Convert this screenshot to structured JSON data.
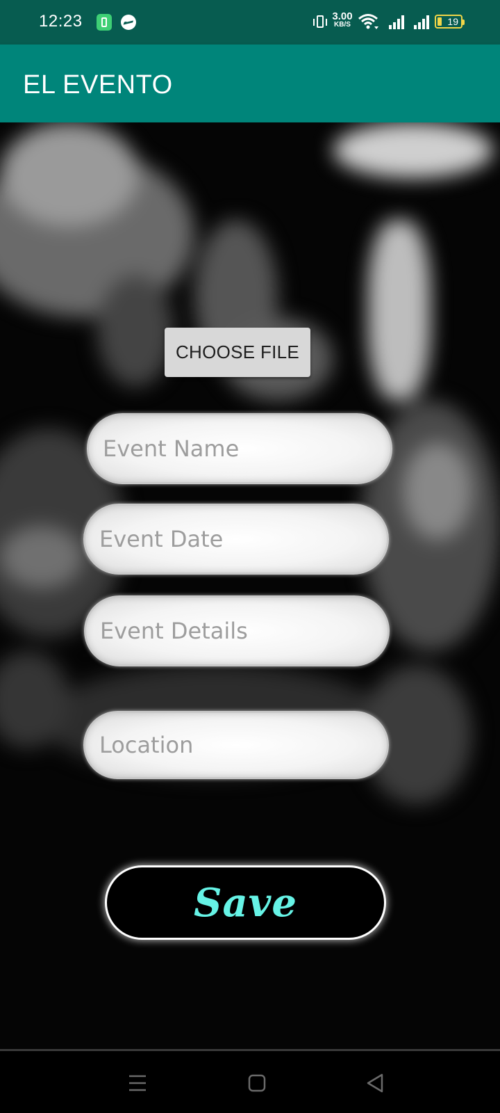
{
  "status_bar": {
    "time": "12:23",
    "network_speed_value": "3.00",
    "network_speed_unit": "KB/S",
    "battery_level": "19",
    "icons": [
      "battery-charging-notification-icon",
      "messenger-icon",
      "vibrate-icon",
      "wifi-icon",
      "signal-icon",
      "signal-icon",
      "battery-icon"
    ]
  },
  "app_bar": {
    "title": "EL EVENTO",
    "color": "#00857a"
  },
  "form": {
    "choose_file_label": "CHOOSE FILE",
    "event_name": {
      "placeholder": "Event Name",
      "value": ""
    },
    "event_date": {
      "placeholder": "Event Date",
      "value": ""
    },
    "event_details": {
      "placeholder": "Event Details",
      "value": ""
    },
    "location": {
      "placeholder": "Location",
      "value": ""
    },
    "save_label": "Save",
    "save_color": "#66f3e6"
  },
  "nav_bar": {
    "icons": [
      "menu-icon",
      "home-square-icon",
      "back-triangle-icon"
    ]
  }
}
